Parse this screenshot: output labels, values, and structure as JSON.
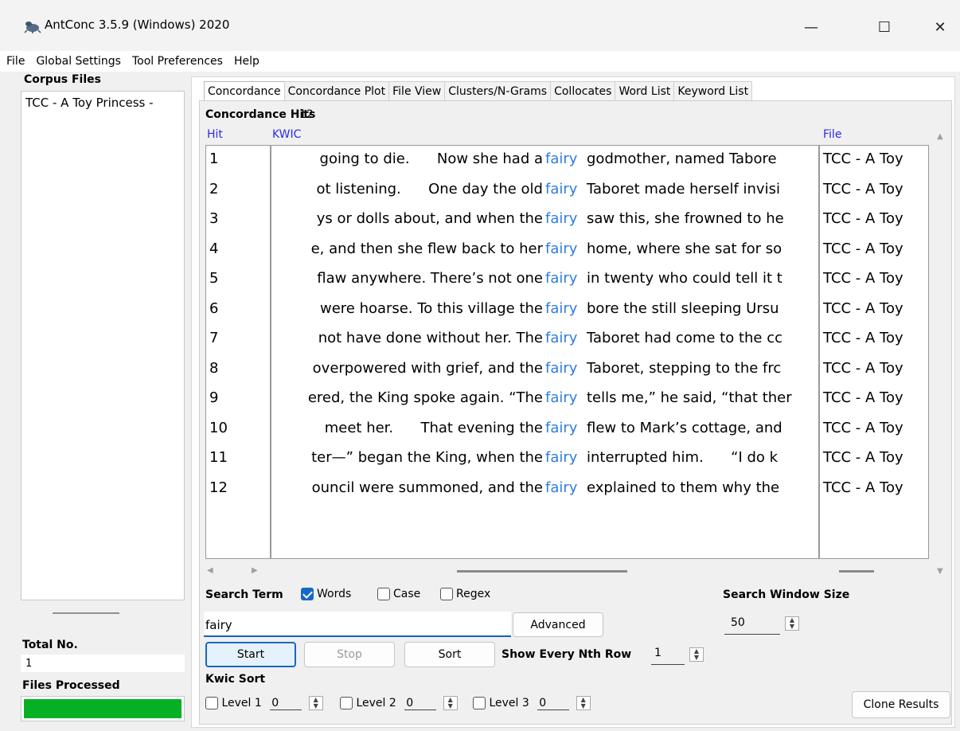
{
  "window": {
    "title": "AntConc 3.5.9 (Windows) 2020",
    "controls": {
      "minimize": "—",
      "maximize": "☐",
      "close": "✕"
    }
  },
  "menu": [
    "File",
    "Global Settings",
    "Tool Preferences",
    "Help"
  ],
  "left_panel": {
    "corpus_title": "Corpus Files",
    "files": [
      "TCC - A Toy Princess -"
    ],
    "total_label": "Total No.",
    "total_value": "1",
    "files_processed_label": "Files Processed",
    "progress": 1.0,
    "progress_color": "#06b025"
  },
  "tabs": [
    {
      "label": "Concordance",
      "active": true
    },
    {
      "label": "Concordance Plot",
      "active": false
    },
    {
      "label": "File View",
      "active": false
    },
    {
      "label": "Clusters/N-Grams",
      "active": false
    },
    {
      "label": "Collocates",
      "active": false
    },
    {
      "label": "Word List",
      "active": false
    },
    {
      "label": "Keyword List",
      "active": false
    }
  ],
  "concordance": {
    "hits_label": "Concordance Hits",
    "hits_count": "12",
    "columns": {
      "hit": "Hit",
      "kwic": "KWIC",
      "file": "File"
    },
    "keyword_color": "#2d7de0",
    "rows": [
      {
        "hit": "1",
        "left": "going to die.      Now she had a",
        "key": "fairy",
        "right": "godmother, named Tabore",
        "file": "TCC - A Toy"
      },
      {
        "hit": "2",
        "left": "ot listening.      One day the old",
        "key": "fairy",
        "right": "Taboret made herself invisi",
        "file": "TCC - A Toy"
      },
      {
        "hit": "3",
        "left": "ys or dolls about, and when the",
        "key": "fairy",
        "right": "saw this, she frowned to he",
        "file": "TCC - A Toy"
      },
      {
        "hit": "4",
        "left": "e, and then she flew back to her",
        "key": "fairy",
        "right": "home, where she sat for so",
        "file": "TCC - A Toy"
      },
      {
        "hit": "5",
        "left": "flaw anywhere. There’s not one",
        "key": "fairy",
        "right": "in twenty who could tell it t",
        "file": "TCC - A Toy"
      },
      {
        "hit": "6",
        "left": "were hoarse. To this village the",
        "key": "fairy",
        "right": "bore the still sleeping Ursu",
        "file": "TCC - A Toy"
      },
      {
        "hit": "7",
        "left": "not have done without her. The",
        "key": "fairy",
        "right": "Taboret had come to the cc",
        "file": "TCC - A Toy"
      },
      {
        "hit": "8",
        "left": "overpowered with grief, and the",
        "key": "fairy",
        "right": "Taboret, stepping to the frc",
        "file": "TCC - A Toy"
      },
      {
        "hit": "9",
        "left": "ered, the King spoke again. “The",
        "key": "fairy",
        "right": "tells me,” he said, “that ther",
        "file": "TCC - A Toy"
      },
      {
        "hit": "10",
        "left": "meet her.      That evening the",
        "key": "fairy",
        "right": "flew to Mark’s cottage, and",
        "file": "TCC - A Toy"
      },
      {
        "hit": "11",
        "left": "ter—” began the King, when the",
        "key": "fairy",
        "right": "interrupted him.      “I do k",
        "file": "TCC - A Toy"
      },
      {
        "hit": "12",
        "left": "ouncil were summoned, and the",
        "key": "fairy",
        "right": "explained to them why the",
        "file": "TCC - A Toy"
      }
    ]
  },
  "search": {
    "term_label": "Search Term",
    "words_label": "Words",
    "words_checked": true,
    "case_label": "Case",
    "case_checked": false,
    "regex_label": "Regex",
    "regex_checked": false,
    "term_value": "fairy",
    "advanced_label": "Advanced",
    "start_label": "Start",
    "stop_label": "Stop",
    "sort_label": "Sort",
    "nth_row_label": "Show Every Nth Row",
    "nth_row_value": "1",
    "window_size_label": "Search Window Size",
    "window_size_value": "50"
  },
  "kwic_sort": {
    "label": "Kwic Sort",
    "levels": [
      {
        "label": "Level 1",
        "value": "0"
      },
      {
        "label": "Level 2",
        "value": "0"
      },
      {
        "label": "Level 3",
        "value": "0"
      }
    ]
  },
  "clone_label": "Clone Results"
}
